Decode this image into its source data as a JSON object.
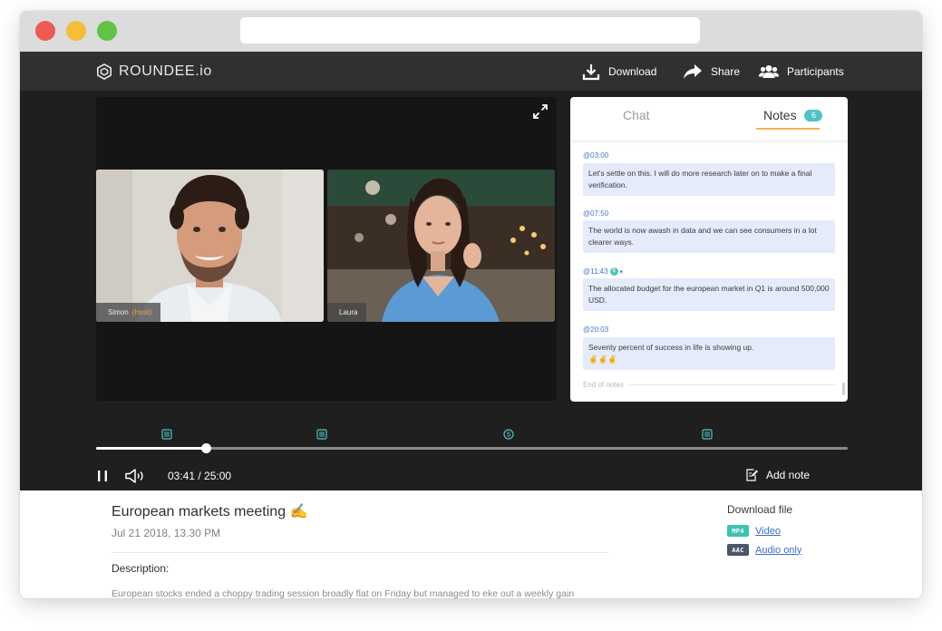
{
  "window": {
    "colors": {
      "close": "#ee5a52",
      "minimize": "#f5bd3a",
      "maximize": "#5fc445"
    },
    "url": ""
  },
  "header": {
    "logo_text": "ROUNDEE.io",
    "download_label": "Download",
    "share_label": "Share",
    "participants_label": "Participants"
  },
  "participants": [
    {
      "name": "Simon",
      "role": "(Host)"
    },
    {
      "name": "Laura",
      "role": ""
    }
  ],
  "panel": {
    "tabs": [
      {
        "label": "Chat",
        "active": false
      },
      {
        "label": "Notes",
        "active": true,
        "badge": "6"
      }
    ],
    "notes": [
      {
        "timestamp": "@03:00",
        "text": "Let's settle on this. I will do more research later on to make a final verification."
      },
      {
        "timestamp": "@07:50",
        "text": "The world is now awash in data and we can see consumers in a lot clearer ways."
      },
      {
        "timestamp": "@11:43",
        "text": "The allocated budget for the european market in Q1 is around 500,000 USD.",
        "icon": "dollar-icon"
      },
      {
        "timestamp": "@20:03",
        "text": "Seventy percent of success in life is showing up.",
        "emoji": "✌✌✌"
      }
    ],
    "end_label": "End of notes"
  },
  "player": {
    "progress": 0.1464,
    "time_text": "03:41 / 25:00",
    "add_note_label": "Add note",
    "markers": [
      {
        "at": 0.0944,
        "icon": "note-icon"
      },
      {
        "at": 0.3006,
        "icon": "note-icon"
      },
      {
        "at": 0.5489,
        "icon": "dollar-icon"
      },
      {
        "at": 0.8129,
        "icon": "note-icon"
      }
    ],
    "accent_color": "#4ec3c4"
  },
  "meeting": {
    "title": "European markets meeting ✍",
    "date": "Jul 21 2018, 13.30 PM",
    "description_label": "Description:",
    "description": "European stocks ended a choppy trading session broadly flat on Friday but managed to eke out a weekly gain"
  },
  "downloads": {
    "title": "Download file",
    "files": [
      {
        "badge": "MP4",
        "label": "Video",
        "color": "#3ec3b0"
      },
      {
        "badge": "AAC",
        "label": "Audio only",
        "color": "#4a5566"
      }
    ]
  }
}
